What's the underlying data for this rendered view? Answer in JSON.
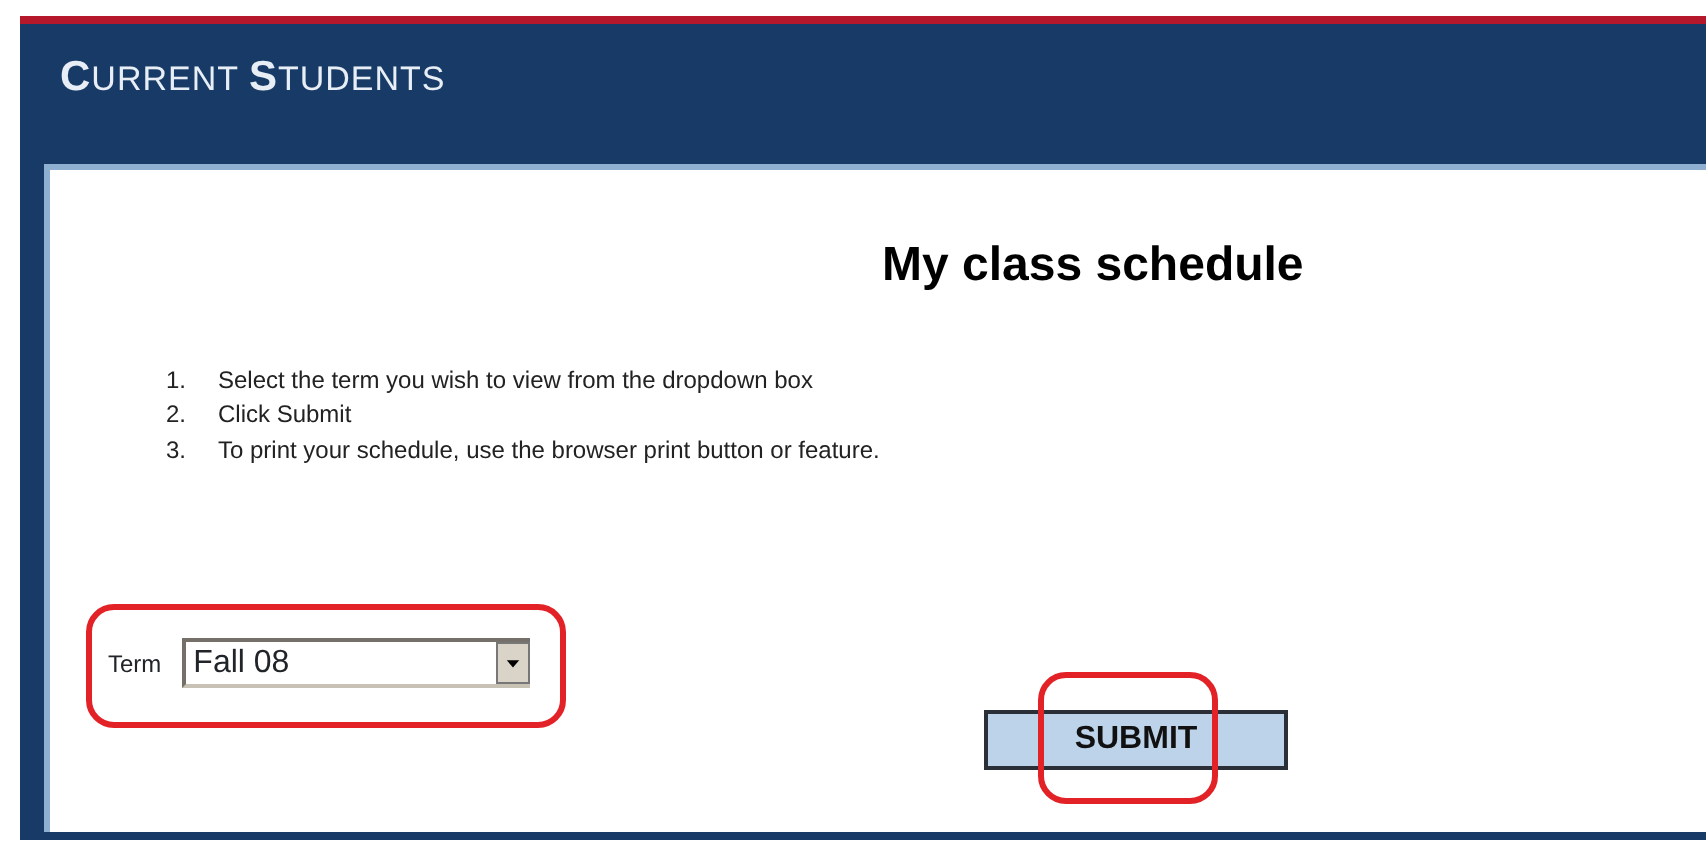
{
  "header": {
    "title": "CURRENT STUDENTS"
  },
  "page_title": "My class schedule",
  "steps": [
    {
      "number": "1.",
      "text": "Select the term you wish to view from the dropdown box"
    },
    {
      "number": "2.",
      "text": "Click Submit"
    },
    {
      "number": "3.",
      "text": "To print your schedule, use the browser print button or feature."
    }
  ],
  "term": {
    "label": "Term",
    "value": "Fall 08",
    "highlighted": true
  },
  "submit": {
    "label": "SUBMIT",
    "highlighted": true
  }
}
